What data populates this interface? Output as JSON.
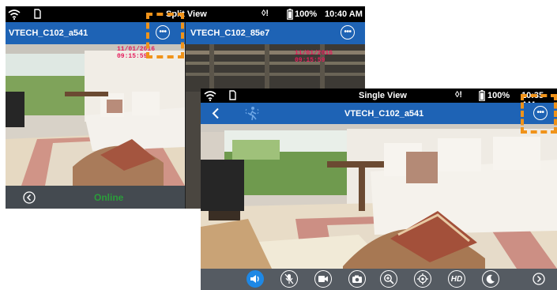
{
  "split_view": {
    "status_bar": {
      "title": "Split View",
      "battery": "100%",
      "time": "10:40 AM"
    },
    "camera1": {
      "name": "VTECH_C102_a541",
      "timestamp": "11/01/2016  09:15:59"
    },
    "camera2": {
      "name": "VTECH_C102_85e7",
      "timestamp": "11/01/2016  09:15:59"
    },
    "footer": {
      "status": "Online"
    }
  },
  "single_view": {
    "status_bar": {
      "title": "Single View",
      "battery": "100%",
      "time": "10:35 AM"
    },
    "title_bar": {
      "camera_name": "VTECH_C102_a541"
    },
    "toolbar": {
      "hd_label": "HD"
    }
  },
  "colors": {
    "title_bar": "#1e63b5",
    "highlight": "#f0931a",
    "online": "#2a9d3a",
    "toolbar": "#555b62",
    "timestamp": "#e41c5b"
  },
  "icons": [
    "wifi-icon",
    "sd-card-icon",
    "alert-icon",
    "battery-icon",
    "more-icon",
    "back-icon",
    "motion-icon",
    "speaker-icon",
    "mic-mute-icon",
    "video-record-icon",
    "camera-snapshot-icon",
    "zoom-icon",
    "pan-tilt-icon",
    "moon-icon",
    "next-icon"
  ]
}
